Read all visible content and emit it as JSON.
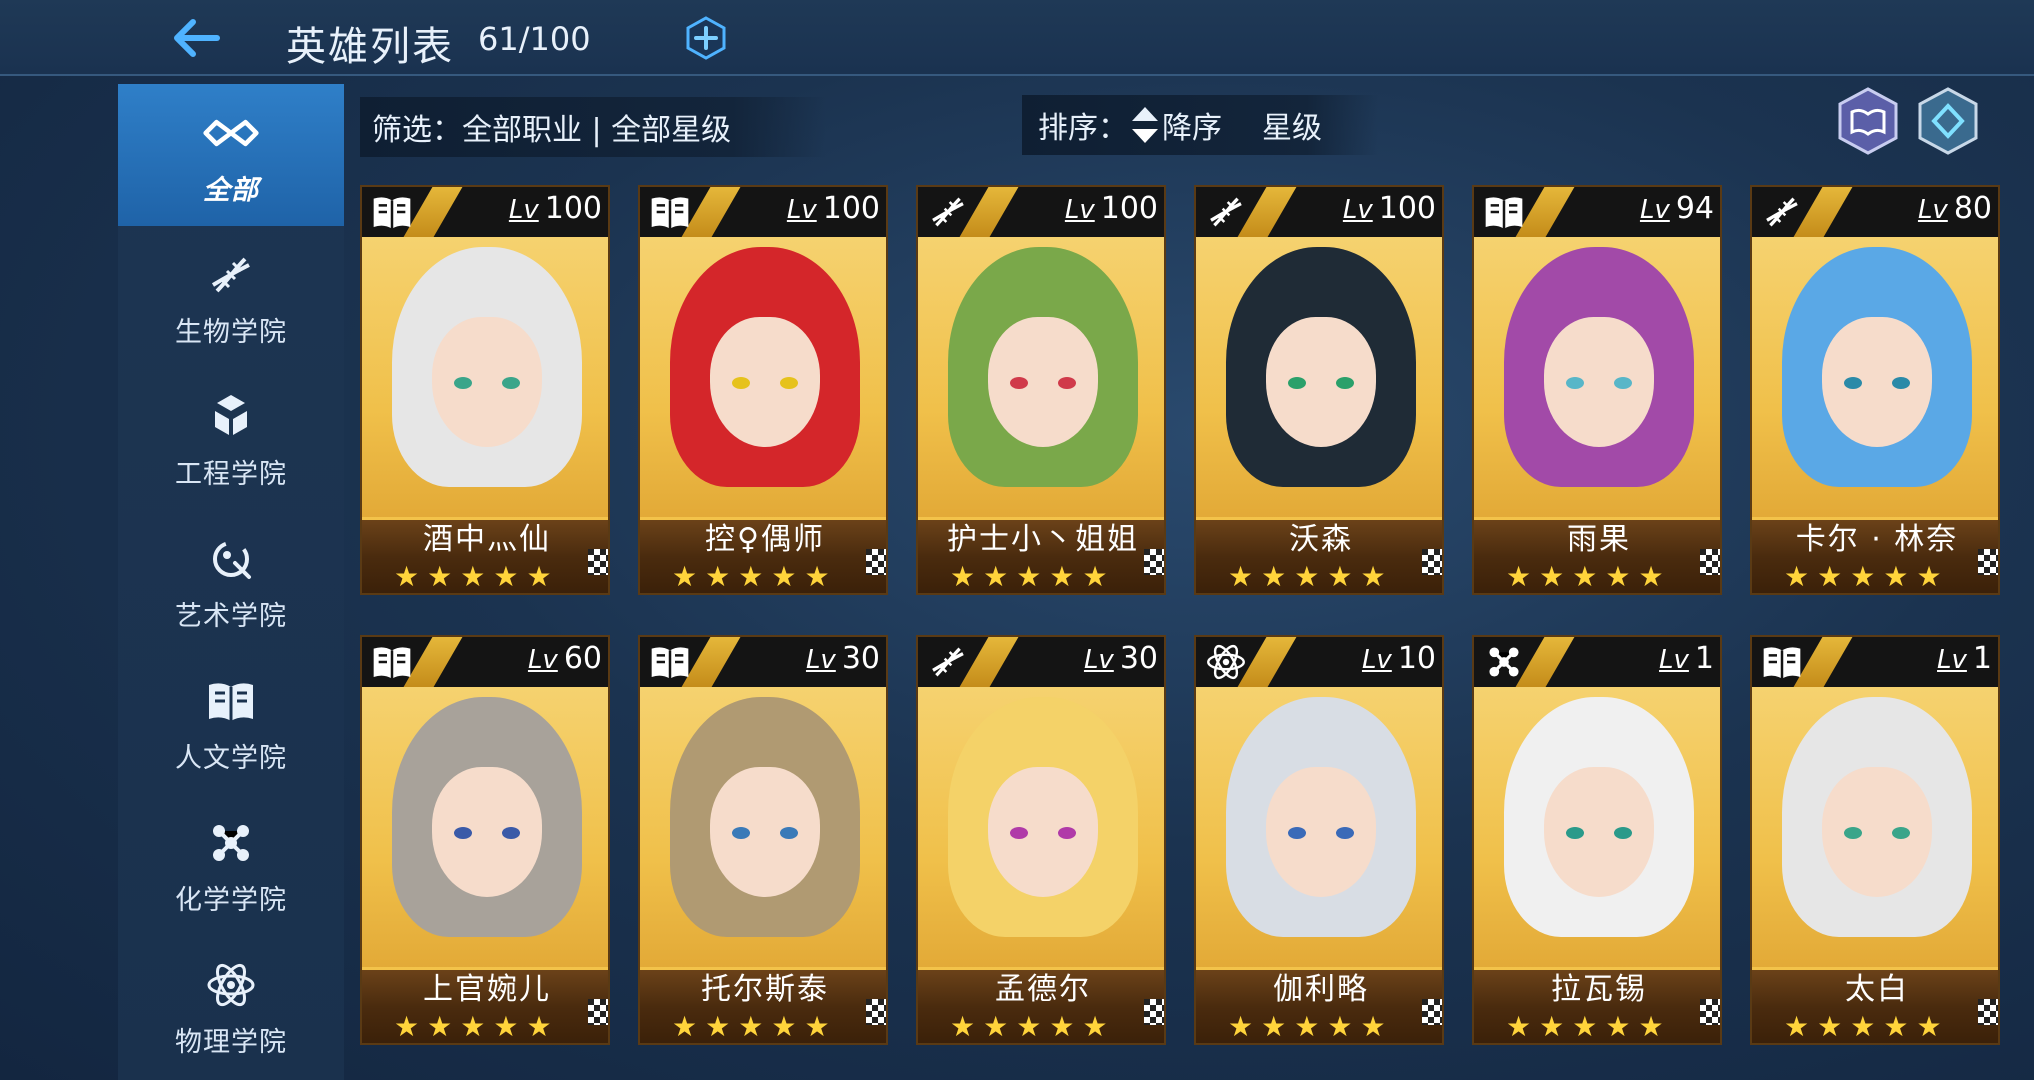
{
  "header": {
    "title": "英雄列表",
    "count": "61/100",
    "back_icon": "arrow-left-icon",
    "add_icon": "plus-hexagon-icon"
  },
  "sidebar": {
    "items": [
      {
        "label": "全部",
        "icon": "infinity-icon",
        "active": true
      },
      {
        "label": "生物学院",
        "icon": "dna-icon",
        "active": false
      },
      {
        "label": "工程学院",
        "icon": "cubes-icon",
        "active": false
      },
      {
        "label": "艺术学院",
        "icon": "palette-icon",
        "active": false
      },
      {
        "label": "人文学院",
        "icon": "book-icon",
        "active": false
      },
      {
        "label": "化学学院",
        "icon": "molecule-icon",
        "active": false
      },
      {
        "label": "物理学院",
        "icon": "atom-icon",
        "active": false
      }
    ]
  },
  "filter": {
    "text": "筛选：全部职业 | 全部星级"
  },
  "sort": {
    "label": "排序：",
    "order": "降序",
    "key": "星级"
  },
  "tools": {
    "codex_icon": "book-hexagon-icon",
    "settings_icon": "diamond-hexagon-icon"
  },
  "colors": {
    "accent": "#2f7fc8",
    "card_gold": "#f0c04a",
    "card_brown": "#4a2b0e",
    "star": "#ffd43b"
  },
  "cards": [
    {
      "name": "酒中灬仙",
      "lv_tag": "Lv",
      "level": "100",
      "class_icon": "book-icon",
      "stars": 5,
      "hair": "#e6e6e6",
      "eye": "#3aa58a"
    },
    {
      "name": "控♀偶师",
      "lv_tag": "Lv",
      "level": "100",
      "class_icon": "book-icon",
      "stars": 5,
      "hair": "#d4262a",
      "eye": "#e6c21c"
    },
    {
      "name": "护士小丶姐姐",
      "lv_tag": "Lv",
      "level": "100",
      "class_icon": "dna-icon",
      "stars": 5,
      "hair": "#7aa84a",
      "eye": "#d03a4a"
    },
    {
      "name": "沃森",
      "lv_tag": "Lv",
      "level": "100",
      "class_icon": "dna-icon",
      "stars": 5,
      "hair": "#1f2b36",
      "eye": "#2aa06a"
    },
    {
      "name": "雨果",
      "lv_tag": "Lv",
      "level": "94",
      "class_icon": "book-icon",
      "stars": 5,
      "hair": "#a24aa8",
      "eye": "#58b6c8"
    },
    {
      "name": "卡尔 · 林奈",
      "lv_tag": "Lv",
      "level": "80",
      "class_icon": "dna-icon",
      "stars": 5,
      "hair": "#5aa8e6",
      "eye": "#2a8aa8"
    },
    {
      "name": "上官婉儿",
      "lv_tag": "Lv",
      "level": "60",
      "class_icon": "book-icon",
      "stars": 5,
      "hair": "#a8a29a",
      "eye": "#3a5aa8"
    },
    {
      "name": "托尔斯泰",
      "lv_tag": "Lv",
      "level": "30",
      "class_icon": "book-icon",
      "stars": 5,
      "hair": "#b09a72",
      "eye": "#3a7ab8"
    },
    {
      "name": "孟德尔",
      "lv_tag": "Lv",
      "level": "30",
      "class_icon": "dna-icon",
      "stars": 5,
      "hair": "#f4d268",
      "eye": "#b03aa8"
    },
    {
      "name": "伽利略",
      "lv_tag": "Lv",
      "level": "10",
      "class_icon": "atom-icon",
      "stars": 5,
      "hair": "#d8dde4",
      "eye": "#3a6ab8"
    },
    {
      "name": "拉瓦锡",
      "lv_tag": "Lv",
      "level": "1",
      "class_icon": "molecule-icon",
      "stars": 5,
      "hair": "#f0f0f0",
      "eye": "#2a9a8a"
    },
    {
      "name": "太白",
      "lv_tag": "Lv",
      "level": "1",
      "class_icon": "book-icon",
      "stars": 5,
      "hair": "#e6e6e6",
      "eye": "#3aa58a"
    }
  ]
}
